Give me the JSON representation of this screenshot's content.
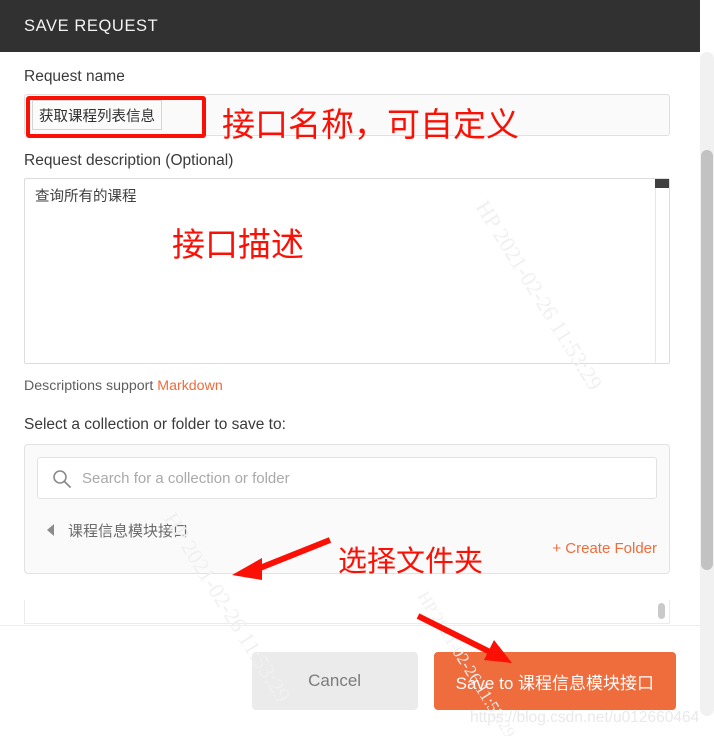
{
  "header": {
    "title": "SAVE REQUEST"
  },
  "form": {
    "name_label": "Request name",
    "name_value": "获取课程列表信息",
    "name_placeholder": "Request name",
    "description_label": "Request description (Optional)",
    "description_value": "查询所有的课程",
    "description_placeholder": "Request description (Optional)",
    "markdown_note_prefix": "Descriptions support ",
    "markdown_link": "Markdown",
    "select_label": "Select a collection or folder to save to:"
  },
  "picker": {
    "search_placeholder": "Search for a collection or folder",
    "search_value": "",
    "search_icon": "search-icon",
    "caret_icon": "caret-left-icon",
    "folder_name": "课程信息模块接口",
    "create_folder_label": "+ Create Folder"
  },
  "footer": {
    "cancel_label": "Cancel",
    "save_label": "Save to 课程信息模块接口"
  },
  "annotations": {
    "name_note": "接口名称，可自定义",
    "description_note": "接口描述",
    "folder_note": "选择文件夹"
  },
  "watermarks": {
    "diagonal": "HP 2021-02-26 11:53:29",
    "url": "https://blog.csdn.net/u012660464"
  },
  "colors": {
    "accent": "#ef6c3c",
    "header_bg": "#313131",
    "annotation_red": "#fb1005"
  }
}
